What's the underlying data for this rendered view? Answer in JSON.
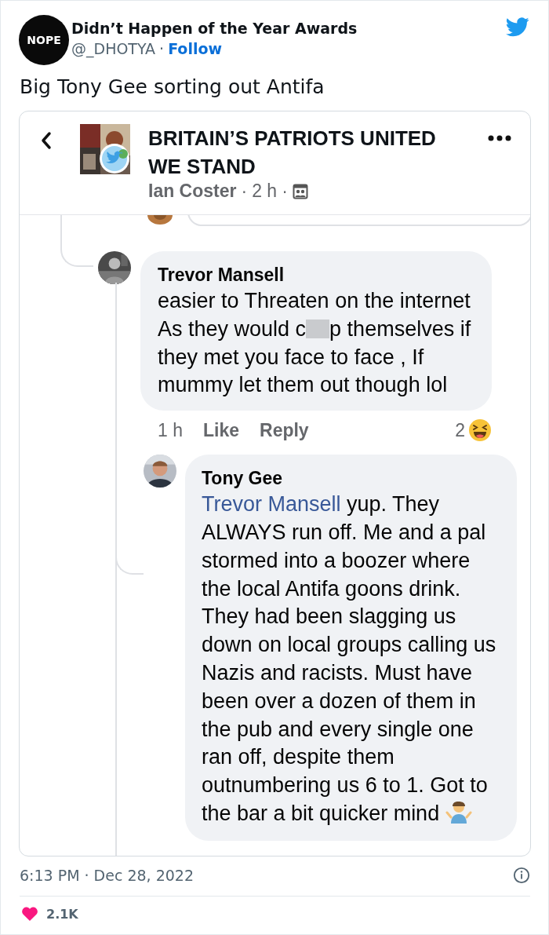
{
  "tweet": {
    "avatar_text": "NOPE",
    "name": "Didn’t Happen of the Year Awards",
    "handle": "@_DHOTYA",
    "separator": "·",
    "follow": "Follow",
    "text": "Big Tony Gee sorting out Antifa",
    "time": "6:13 PM",
    "date": "Dec 28, 2022",
    "likes": "2.1K"
  },
  "embed": {
    "group_title": "BRITAIN’S PATRIOTS UNITED WE STAND",
    "author": "Ian Coster",
    "separator": "·",
    "age": "2 h",
    "comments": [
      {
        "name": "Trevor Mansell",
        "before": "easier to Threaten on the internet As they would c",
        "after": "p themselves if they met you face to face , If mummy let them out though lol",
        "time": "1 h",
        "like": "Like",
        "reply": "Reply",
        "reactions": "2"
      },
      {
        "name": "Tony Gee",
        "mention": "Trevor Mansell",
        "text": "yup. They ALWAYS run  off. Me and a pal stormed into a boozer where the local Antifa goons drink. They had been slagging us down on local groups calling us Nazis and racists. Must have been over a dozen of them in the pub and every single one ran off, despite them outnumbering us 6 to 1. Got to the bar a bit quicker mind"
      }
    ]
  }
}
